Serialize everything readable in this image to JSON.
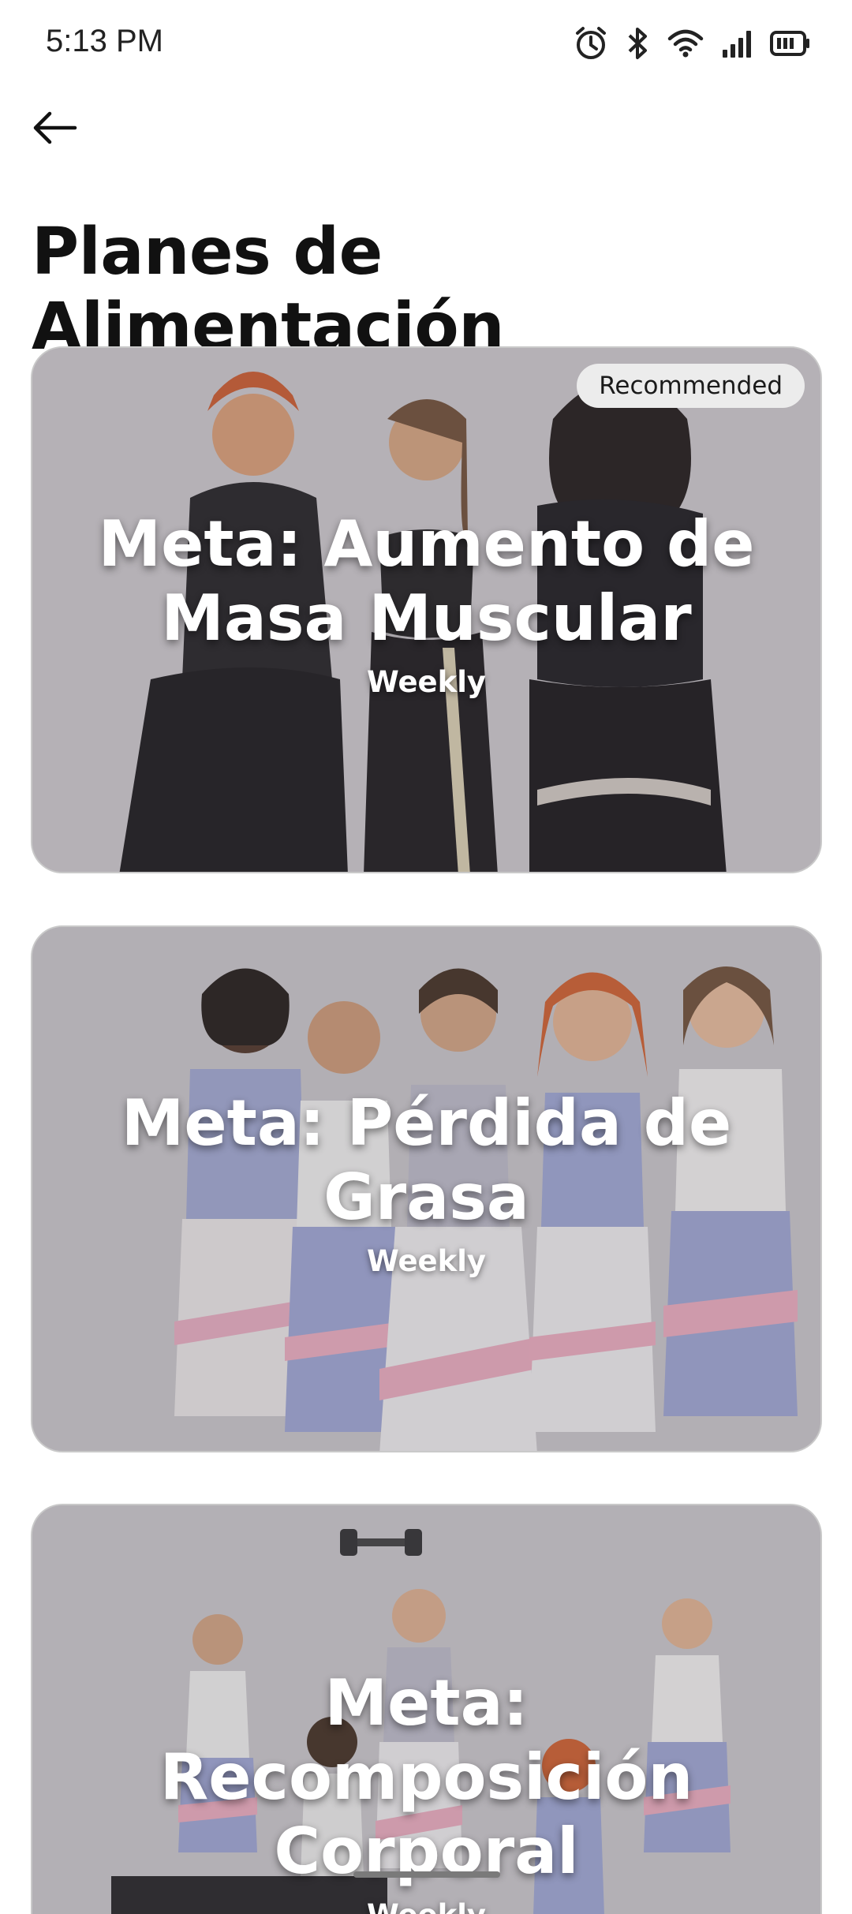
{
  "status_bar": {
    "time": "5:13 PM",
    "icons": [
      "alarm-icon",
      "bluetooth-icon",
      "wifi-icon",
      "signal-icon",
      "battery-icon"
    ]
  },
  "header": {
    "back_icon": "arrow-left-icon",
    "title": "Planes de Alimentación"
  },
  "plans": [
    {
      "goal": "Meta: Aumento de Masa Muscular",
      "frequency": "Weekly",
      "badge": "Recommended"
    },
    {
      "goal": "Meta: Pérdida de Grasa",
      "frequency": "Weekly"
    },
    {
      "goal": "Meta: Recomposición Corporal",
      "frequency": "Weekly"
    }
  ],
  "colors": {
    "background": "#ffffff",
    "title": "#111111",
    "overlay_text": "#ffffff",
    "badge_bg": "#ececec"
  }
}
